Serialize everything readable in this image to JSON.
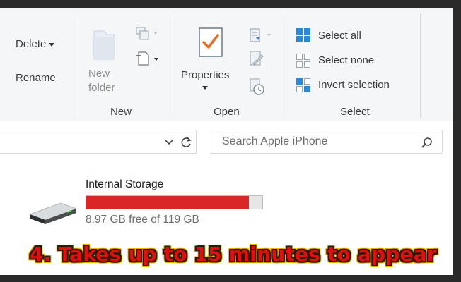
{
  "ribbon": {
    "organize": {
      "delete_label": "Delete",
      "rename_label": "Rename"
    },
    "new_group": {
      "new_folder_line1": "New",
      "new_folder_line2": "folder",
      "group_label": "New"
    },
    "open_group": {
      "properties_label": "Properties",
      "group_label": "Open"
    },
    "select_group": {
      "select_all": "Select all",
      "select_none": "Select none",
      "invert_selection": "Invert selection",
      "group_label": "Select"
    }
  },
  "search": {
    "placeholder": "Search Apple iPhone"
  },
  "drive": {
    "name": "Internal Storage",
    "free_text": "8.97 GB free of 119 GB",
    "used_fraction": 0.925,
    "bar_color": "#da2626"
  },
  "caption": {
    "text": "4. Takes up to 15 minutes to appear",
    "color": "#e10f0f"
  }
}
